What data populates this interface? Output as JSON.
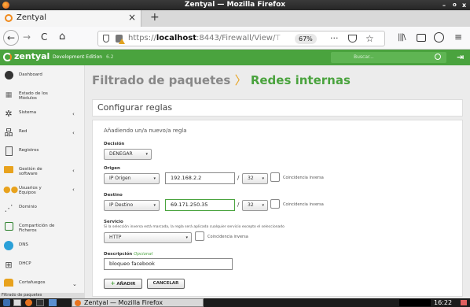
{
  "window": {
    "title": "Zentyal — Mozilla Firefox",
    "controls": [
      "–",
      "o",
      "x"
    ]
  },
  "tab": {
    "label": "Zentyal",
    "close": "×",
    "new_tab": "+"
  },
  "nav": {
    "back": "←",
    "forward": "→",
    "reload": "C",
    "home": "⌂",
    "url_prefix": "https://",
    "url_host": "localhost",
    "url_rest": ":8443/Firewall/View/",
    "url_tail": "T",
    "zoom": "67%",
    "menu_dots": "···"
  },
  "zentyal": {
    "brand": "zentyal",
    "edition": "Development Edition",
    "version": "6.2",
    "search_placeholder": "Buscar..."
  },
  "sidebar": {
    "items": [
      {
        "label1": "Dashboard",
        "label2": "",
        "icon": "dashboard-icon",
        "chev": ""
      },
      {
        "label1": "Estado de los",
        "label2": "Módulos",
        "icon": "modules-icon",
        "chev": ""
      },
      {
        "label1": "Sistema",
        "label2": "",
        "icon": "gear-icon",
        "chev": "‹"
      },
      {
        "label1": "Red",
        "label2": "",
        "icon": "network-icon",
        "chev": "‹"
      },
      {
        "label1": "Registros",
        "label2": "",
        "icon": "logs-icon",
        "chev": ""
      },
      {
        "label1": "Gestión de",
        "label2": "software",
        "icon": "software-icon",
        "chev": "‹"
      },
      {
        "label1": "Usuarios y",
        "label2": "Equipos",
        "icon": "users-icon",
        "chev": "‹"
      },
      {
        "label1": "Dominio",
        "label2": "",
        "icon": "domain-icon",
        "chev": ""
      },
      {
        "label1": "Compartición de",
        "label2": "Ficheros",
        "icon": "file-share-icon",
        "chev": ""
      },
      {
        "label1": "DNS",
        "label2": "",
        "icon": "dns-icon",
        "chev": ""
      },
      {
        "label1": "DHCP",
        "label2": "",
        "icon": "dhcp-icon",
        "chev": ""
      },
      {
        "label1": "Cortafuegos",
        "label2": "",
        "icon": "firewall-icon",
        "chev": "⌄"
      }
    ],
    "sub_item": "Filtrado de paquetes"
  },
  "main": {
    "crumb_parent": "Filtrado de paquetes",
    "crumb_sep": "〉",
    "crumb_current": "Redes internas",
    "section_title": "Configurar reglas",
    "form_title": "Añadiendo un/a nuevo/a regla",
    "decision_label": "Decisión",
    "decision_value": "DENEGAR",
    "origin_label": "Origen",
    "origin_type": "IP Origen",
    "origin_ip": "192.168.2.2",
    "origin_mask": "32",
    "origin_inverse": "Coincidencia inversa",
    "dest_label": "Destino",
    "dest_type": "IP Destino",
    "dest_ip": "69.171.250.35",
    "dest_mask": "32",
    "dest_inverse": "Coincidencia inversa",
    "service_label": "Servicio",
    "service_help": "Si la selección inversa está marcada, la regla será aplicada cualquier servicio excepto el seleccionado",
    "service_value": "HTTP",
    "service_inverse": "Coincidencia inversa",
    "desc_label": "Descripción",
    "desc_optional": "Opcional",
    "desc_value": "bloqueo facebook",
    "add_button": "AÑADIR",
    "add_icon": "+",
    "cancel_button": "CANCELAR",
    "slash": "/"
  },
  "taskbar": {
    "window_label": "Zentyal — Mozilla Firefox",
    "clock": "16:22"
  },
  "colors": {
    "green": "#4aa33e",
    "titlebar": "#2f2f2f"
  }
}
